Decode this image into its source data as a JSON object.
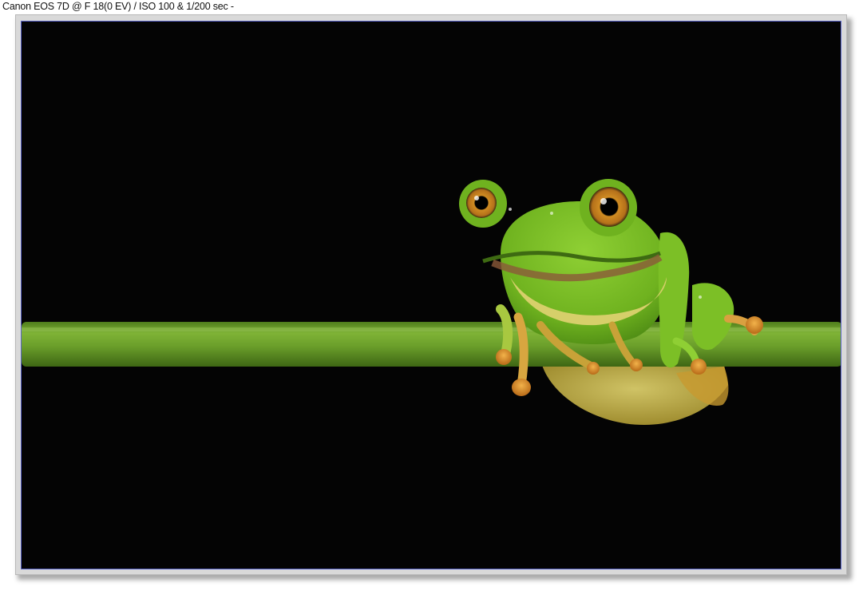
{
  "caption": {
    "text": "Canon EOS 7D @ F 18(0 EV) / ISO 100 & 1/200 sec -"
  },
  "photo": {
    "subject": "green tree frog perched on a green stem against black background",
    "background_color": "#040404",
    "border_color": "#5a64c8"
  },
  "colors": {
    "frame": "#d9d9d9",
    "stem": "#6a9e2a",
    "frog_body": "#7cbf26",
    "frog_belly": "#c8b640",
    "eye_iris": "#c07a18"
  }
}
